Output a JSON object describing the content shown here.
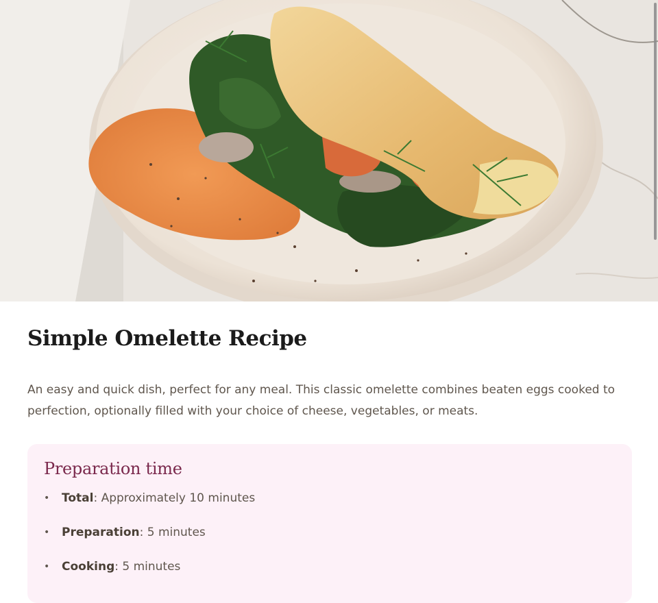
{
  "hero_image": {
    "icon": "omelette-plate-photo",
    "colors": {
      "marble": "#e7e2dc",
      "plate": "#efe7de",
      "omelette": "#e9c07a",
      "spread": "#e48a47",
      "spinach": "#274a22"
    }
  },
  "recipe": {
    "title": "Simple Omelette Recipe",
    "description": "An easy and quick dish, perfect for any meal. This classic omelette combines beaten eggs cooked to perfection, optionally filled with your choice of cheese, vegetables, or meats."
  },
  "preparation": {
    "heading": "Preparation time",
    "items": [
      {
        "label": "Total",
        "value": ": Approximately 10 minutes"
      },
      {
        "label": "Preparation",
        "value": ": 5 minutes"
      },
      {
        "label": "Cooking",
        "value": ": 5 minutes"
      }
    ],
    "bullet": "•"
  },
  "theme": {
    "heading_color": "#7a284c",
    "panel_bg": "#fdf1f8",
    "text_color": "#5f564d"
  }
}
